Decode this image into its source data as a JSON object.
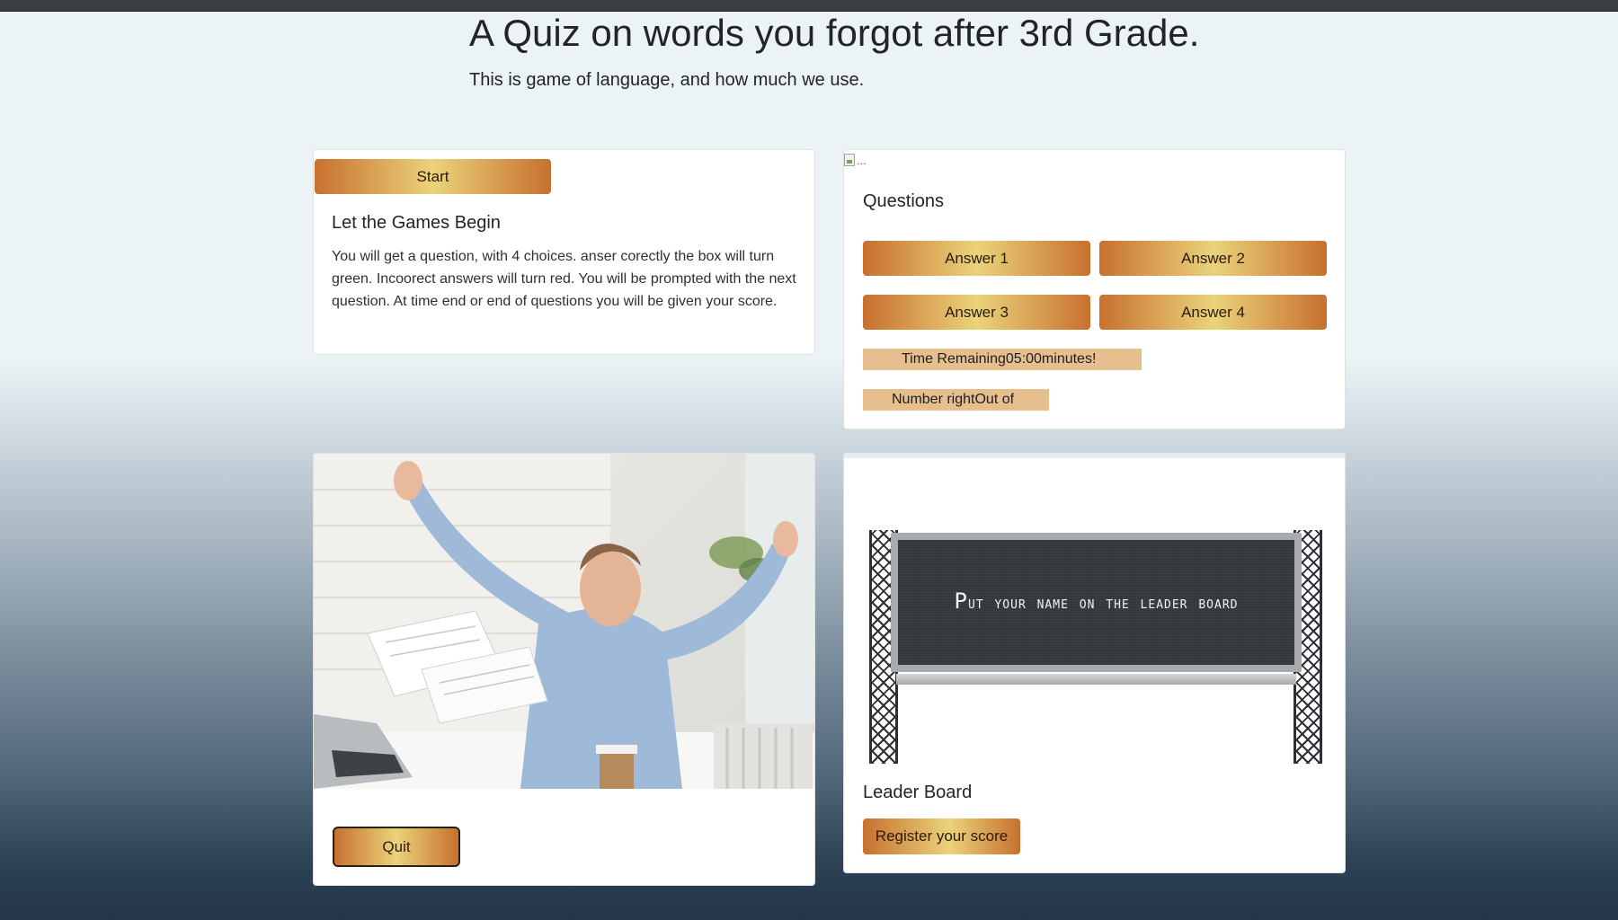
{
  "header": {
    "title": "A Quiz on words you forgot after 3rd Grade.",
    "subtitle": "This is game of language, and how much we use."
  },
  "start_card": {
    "start_label": "Start",
    "title": "Let the Games Begin",
    "text": "You will get a question, with 4 choices. anser corectly the box will turn green. Incoorect answers will turn red. You will be prompted with the next question. At time end or end of questions you will be given your score."
  },
  "questions_card": {
    "image_alt": "...",
    "title": "Questions",
    "answers": [
      "Answer 1",
      "Answer 2",
      "Answer 3",
      "Answer 4"
    ],
    "timer_text": "Time Remaining05:00minutes!",
    "score_text": "Number rightOut of"
  },
  "quit_card": {
    "quit_label": "Quit"
  },
  "leader_card": {
    "billboard_first": "P",
    "billboard_rest": "UT YOUR NAME ON THE LEADER BOARD",
    "title": "Leader Board",
    "register_label": "Register your score"
  },
  "colors": {
    "button_gold_dark": "#c8702f",
    "button_gold_light": "#ead37a",
    "label_tan": "#e6bf8e"
  }
}
